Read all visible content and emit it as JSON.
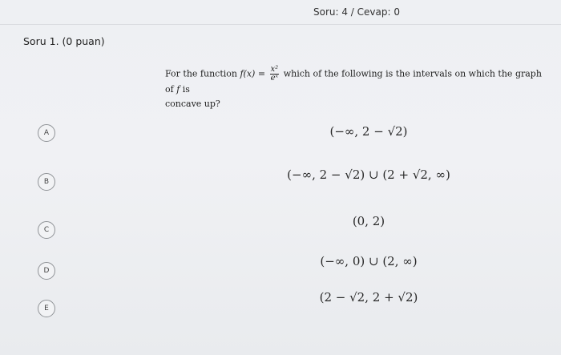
{
  "header": {
    "counter": "Soru: 4 / Cevap: 0"
  },
  "question": {
    "title": "Soru 1. (0 puan)",
    "stem_prefix": "For the function",
    "function_lhs": "f(x) =",
    "fraction_numerator": "x²",
    "fraction_denominator": "eˣ",
    "stem_suffix": "which of the following is the intervals on which the graph of",
    "stem_f": "f",
    "stem_is": "is",
    "stem_line2": "concave up?"
  },
  "options": [
    {
      "letter": "A",
      "text": "(−∞, 2 − √2)"
    },
    {
      "letter": "B",
      "text": "(−∞, 2 − √2) ∪ (2 + √2, ∞)"
    },
    {
      "letter": "C",
      "text": "(0, 2)"
    },
    {
      "letter": "D",
      "text": "(−∞, 0) ∪ (2, ∞)"
    },
    {
      "letter": "E",
      "text": "(2 − √2, 2 + √2)"
    }
  ]
}
